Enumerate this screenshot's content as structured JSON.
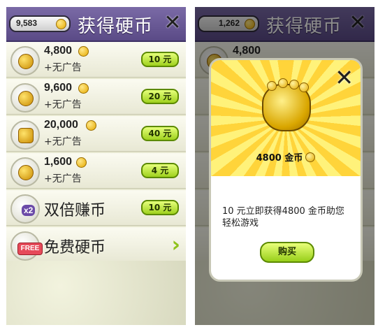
{
  "left": {
    "header": {
      "coins": "9,583",
      "title": "获得硬币"
    },
    "rows": [
      {
        "amount": "4,800",
        "subtitle": "+无广告",
        "price": "10 元"
      },
      {
        "amount": "9,600",
        "subtitle": "+无广告",
        "price": "20 元"
      },
      {
        "amount": "20,000",
        "subtitle": "+无广告",
        "price": "40 元"
      },
      {
        "amount": "1,600",
        "subtitle": "+无广告",
        "price": "4 元"
      },
      {
        "label": "双倍赚币",
        "price": "10 元",
        "badge": "x2"
      },
      {
        "label": "免费硬币",
        "badge": "FREE"
      }
    ]
  },
  "right": {
    "header": {
      "coins": "1,262",
      "title": "获得硬币"
    },
    "bg_rows": [
      {
        "amount": "4,800"
      }
    ],
    "modal": {
      "amount_text": "4800 金币",
      "description": "10 元立即获得4800 金币助您轻松游戏",
      "buy_label": "购买"
    }
  },
  "colors": {
    "header_purple": "#6a5a96",
    "button_green": "#9fd11e",
    "coin_gold": "#e5a900"
  },
  "icons": [
    "close-icon",
    "coin-icon",
    "coin-bag-icon",
    "treasure-chest-icon",
    "coin-stack-icon",
    "chevron-right-icon",
    "double-badge-icon",
    "free-badge-icon"
  ]
}
